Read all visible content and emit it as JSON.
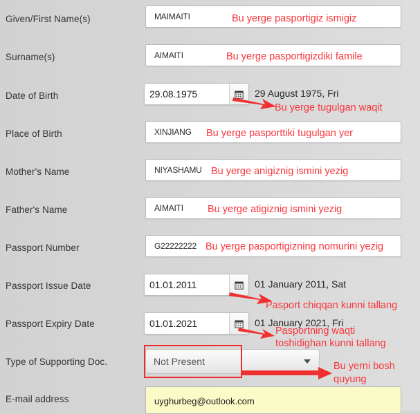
{
  "form": {
    "background_color": "#d4d4d4",
    "annotation_color": "#f8353a",
    "highlight_color": "#ef2b2b",
    "email_field_color": "#fbfbc8",
    "rows": [
      {
        "label": "Given/First Name(s)",
        "type": "text",
        "value": "MAIMAITI",
        "annotation": "Bu yerge pasportigiz ismigiz"
      },
      {
        "label": "Surname(s)",
        "type": "text",
        "value": "AIMAITI",
        "annotation": "Bu yerge pasportigizdiki famile"
      },
      {
        "label": "Date of Birth",
        "type": "date",
        "value": "29.08.1975",
        "readout": "29 August 1975, Fri",
        "icon": "calendar-icon",
        "annotation": "Bu yerge tugulgan waqit"
      },
      {
        "label": "Place of Birth",
        "type": "text",
        "value": "XINJIANG",
        "annotation": "Bu yerge pasporttiki tugulgan yer"
      },
      {
        "label": "Mother's Name",
        "type": "text",
        "value": "NIYASHAMU",
        "annotation": "Bu yerge anigiznig ismini yezig"
      },
      {
        "label": "Father's Name",
        "type": "text",
        "value": "AIMAITI",
        "annotation": "Bu yerge atigiznig ismini yezig"
      },
      {
        "label": "Passport Number",
        "type": "text",
        "value": "G22222222",
        "annotation": "Bu yerge pasportigizning nomurini yezig"
      },
      {
        "label": "Passport Issue Date",
        "type": "date",
        "value": "01.01.2011",
        "readout": "01 January 2011, Sat",
        "icon": "calendar-icon",
        "annotation": "Pasport chiqqan kunni tallang"
      },
      {
        "label": "Passport Expiry Date",
        "type": "date",
        "value": "01.01.2021",
        "readout": "01 January 2021, Fri",
        "icon": "calendar-icon",
        "annotation_line1": "Pasportning waqti",
        "annotation_line2": "toshidighan kunni tallang"
      },
      {
        "label": "Type of Supporting Doc.",
        "type": "select",
        "value": "Not Present",
        "icon": "chevron-down-icon",
        "annotation_line1": "Bu yerni bosh",
        "annotation_line2": "quyung"
      },
      {
        "label": "E-mail address",
        "type": "email",
        "value": "uyghurbeg@outlook.com"
      }
    ]
  }
}
